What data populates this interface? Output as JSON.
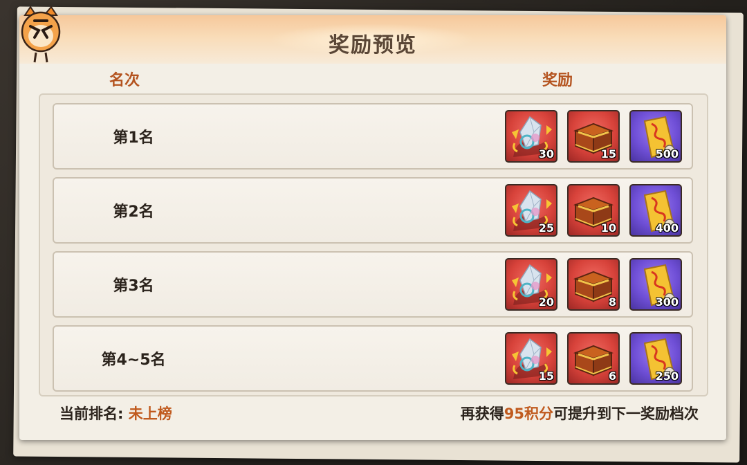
{
  "title": "奖励预览",
  "columns": {
    "rank": "名次",
    "reward": "奖励"
  },
  "rows": [
    {
      "rank": "第1名",
      "rewards": [
        "30",
        "15",
        "500"
      ]
    },
    {
      "rank": "第2名",
      "rewards": [
        "25",
        "10",
        "400"
      ]
    },
    {
      "rank": "第3名",
      "rewards": [
        "20",
        "8",
        "300"
      ]
    },
    {
      "rank": "第4~5名",
      "rewards": [
        "15",
        "6",
        "250"
      ]
    }
  ],
  "reward_icons": [
    "crystal-icon",
    "treasure-chest-icon",
    "ticket-icon"
  ],
  "footer": {
    "current_rank_label": "当前排名:",
    "current_rank_value": "未上榜",
    "hint_prefix": "再获得",
    "hint_points": "95积分",
    "hint_suffix": "可提升到下一奖励档次"
  },
  "colors": {
    "accent": "#c05a1e",
    "column_header": "#b4531f",
    "item_red": "#d7423a",
    "item_purple": "#6f4fd6"
  }
}
